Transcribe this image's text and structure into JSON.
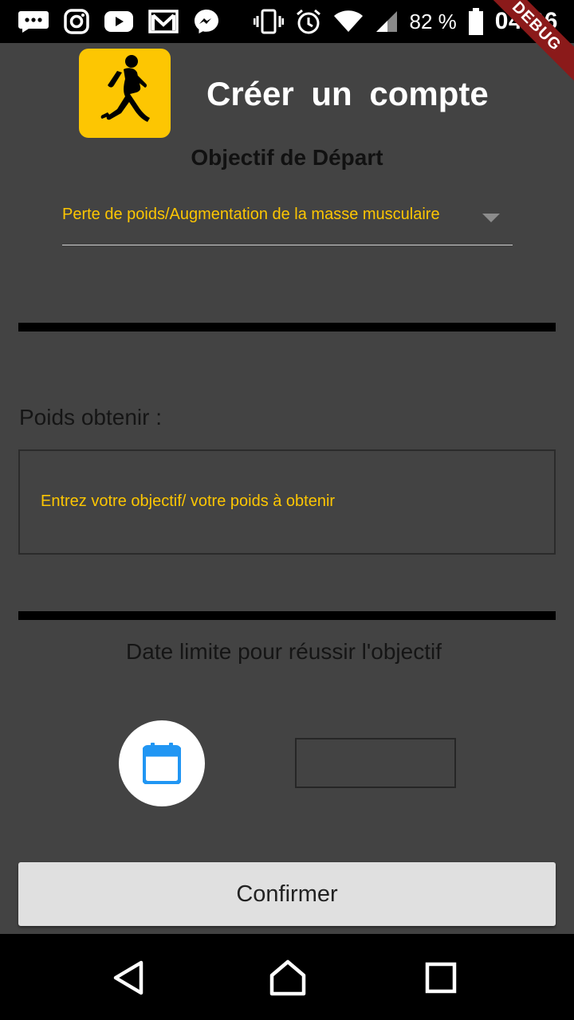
{
  "status_bar": {
    "battery_percent": "82 %",
    "time": "04:06",
    "icons": [
      "chat-bubble-icon",
      "instagram-icon",
      "youtube-icon",
      "gmail-icon",
      "messenger-icon",
      "vibrate-icon",
      "alarm-icon",
      "wifi-icon",
      "signal-icon",
      "battery-icon"
    ]
  },
  "debug_banner": "DEBUG",
  "header": {
    "title": "Créer un compte",
    "logo_icon": "runner-icon",
    "logo_color": "#fdc602"
  },
  "objective": {
    "section_title": "Objectif de Départ",
    "selected_value": "Perte de poids/Augmentation de la masse musculaire"
  },
  "weight": {
    "label": "Poids obtenir :",
    "placeholder": "Entrez votre objectif/ votre poids à obtenir"
  },
  "deadline": {
    "label": "Date limite pour réussir l'objectif",
    "calendar_icon": "calendar-icon",
    "date_value": ""
  },
  "actions": {
    "confirm_label": "Confirmer"
  },
  "nav_bar": {
    "icons": [
      "back-icon",
      "home-icon",
      "recents-icon"
    ]
  },
  "colors": {
    "background": "#434343",
    "accent": "#fdc602",
    "calendar_blue": "#2196f3"
  }
}
